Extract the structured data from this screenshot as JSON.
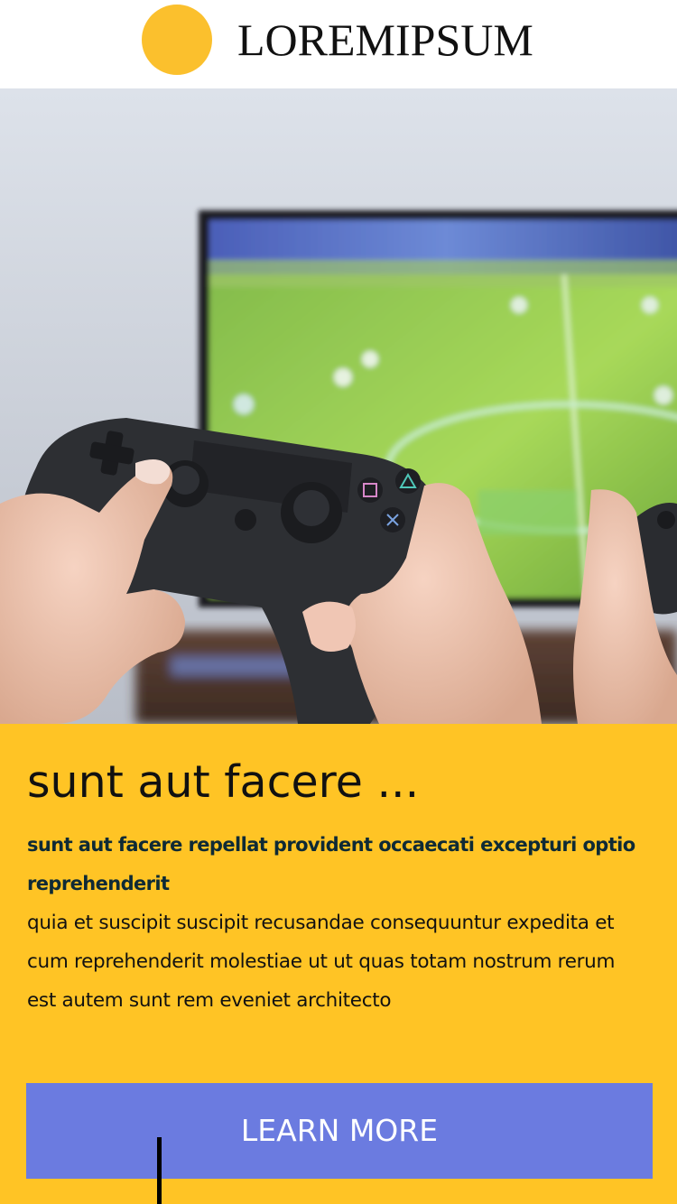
{
  "header": {
    "logo_text": "LOREMIPSUM",
    "logo_color": "#fbc02d"
  },
  "hero": {
    "image_icon": "gamepad-photo"
  },
  "card": {
    "title": "sunt aut facere ...",
    "subtitle": "sunt aut facere repellat provident occaecati excepturi optio reprehenderit",
    "body": "quia et suscipit suscipit recusandae consequuntur expedita et cum reprehenderit molestiae ut ut quas totam nostrum rerum est autem sunt rem eveniet architecto",
    "button_label": "LEARN MORE",
    "background_color": "#ffc425",
    "button_color": "#6b7be0"
  }
}
